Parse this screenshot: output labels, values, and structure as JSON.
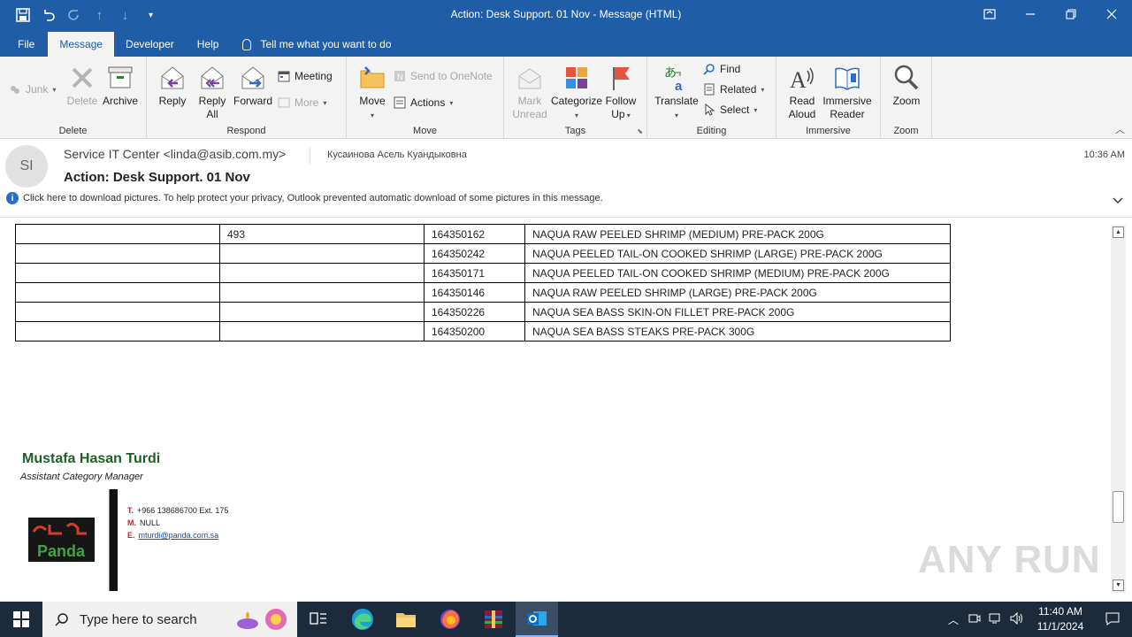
{
  "window": {
    "title": "Action: Desk Support. 01 Nov  -  Message (HTML)"
  },
  "tabs": [
    {
      "label": "File"
    },
    {
      "label": "Message"
    },
    {
      "label": "Developer"
    },
    {
      "label": "Help"
    }
  ],
  "tell_me": "Tell me what you want to do",
  "ribbon": {
    "delete_group": {
      "label": "Delete",
      "junk": "Junk",
      "delete": "Delete",
      "archive": "Archive"
    },
    "respond_group": {
      "label": "Respond",
      "reply": "Reply",
      "reply_all_1": "Reply",
      "reply_all_2": "All",
      "forward": "Forward",
      "meeting": "Meeting",
      "more": "More"
    },
    "move_group": {
      "label": "Move",
      "move": "Move",
      "send_onenote": "Send to OneNote",
      "actions": "Actions"
    },
    "tags_group": {
      "label": "Tags",
      "mark_unread_1": "Mark",
      "mark_unread_2": "Unread",
      "categorize": "Categorize",
      "follow_up_1": "Follow",
      "follow_up_2": "Up"
    },
    "editing_group": {
      "label": "Editing",
      "translate": "Translate",
      "find": "Find",
      "related": "Related",
      "select": "Select"
    },
    "immersive_group": {
      "label": "Immersive",
      "read_aloud_1": "Read",
      "read_aloud_2": "Aloud",
      "immersive_reader_1": "Immersive",
      "immersive_reader_2": "Reader"
    },
    "zoom_group": {
      "label": "Zoom",
      "zoom": "Zoom"
    }
  },
  "message": {
    "avatar_initials": "SI",
    "from": "Service IT Center <linda@asib.com.my>",
    "to": "Кусаинова Асель Куандыковна",
    "time": "10:36 AM",
    "subject": "Action: Desk Support. 01 Nov",
    "info_bar": "Click here to download pictures. To help protect your privacy, Outlook prevented automatic download of some pictures in this message."
  },
  "table_rows": [
    {
      "c1": "",
      "c2": "493",
      "c3": "164350162",
      "c4": "NAQUA RAW PEELED SHRIMP (MEDIUM)  PRE-PACK 200G"
    },
    {
      "c1": "",
      "c2": "",
      "c3": "164350242",
      "c4": "NAQUA PEELED TAIL-ON COOKED SHRIMP (LARGE)  PRE-PACK 200G"
    },
    {
      "c1": "",
      "c2": "",
      "c3": "164350171",
      "c4": "NAQUA PEELED TAIL-ON COOKED SHRIMP (MEDIUM)  PRE-PACK 200G"
    },
    {
      "c1": "",
      "c2": "",
      "c3": "164350146",
      "c4": "NAQUA RAW PEELED SHRIMP (LARGE)  PRE-PACK 200G"
    },
    {
      "c1": "",
      "c2": "",
      "c3": "164350226",
      "c4": "NAQUA SEA BASS SKIN-ON FILLET PRE-PACK 200G"
    },
    {
      "c1": "",
      "c2": "",
      "c3": "164350200",
      "c4": "NAQUA SEA BASS STEAKS PRE-PACK 300G"
    }
  ],
  "signature": {
    "name": "Mustafa Hasan Turdi",
    "role": "Assistant Category Manager",
    "logo_text": "Panda",
    "t_label": "T.",
    "t_value": "+966 138686700 Ext. 175",
    "m_label": "M.",
    "m_value": "NULL",
    "e_label": "E.",
    "e_value": "mturdi@panda.com.sa"
  },
  "watermark": "ANY RUN",
  "taskbar": {
    "search_placeholder": "Type here to search",
    "time": "11:40 AM",
    "date": "11/1/2024"
  },
  "colors": {
    "title_bar": "#1f5da7",
    "ribbon_bg": "#f3f3f3",
    "signature_green": "#1d5e2a",
    "taskbar_bg": "#1b2b3c"
  }
}
